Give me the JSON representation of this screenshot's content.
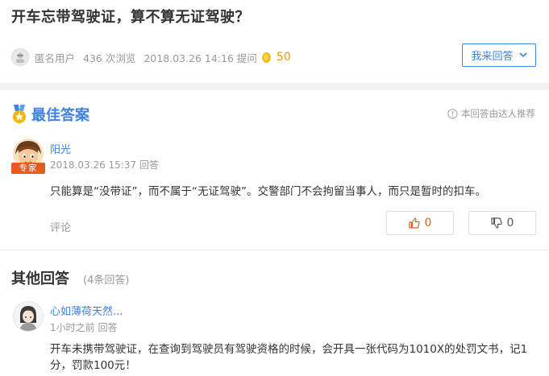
{
  "question": {
    "title": "开车忘带驾驶证，算不算无证驾驶？",
    "asker": "匿名用户",
    "views": "436 次浏览",
    "time": "2018.03.26 14:16 提问",
    "reward": "50",
    "answer_button": "我来回答"
  },
  "best_answer": {
    "heading": "最佳答案",
    "recommend_note": "本回答由达人推荐",
    "author": "阳光",
    "badge": "专家",
    "time": "2018.03.26 15:37 回答",
    "text": "只能算是“没带证”，而不属于“无证驾驶”。交警部门不会拘留当事人，而只是暂时的扣车。",
    "comment_label": "评论",
    "upvotes": "0",
    "downvotes": "0"
  },
  "other_answers": {
    "heading": "其他回答",
    "count": "(4条回答)",
    "items": [
      {
        "author": "心如薄荷天然...",
        "time": "1小时之前 回答",
        "text": "开车未携带驾驶证，在查询到驾驶员有驾驶资格的时候，会开具一张代码为1010X的处罚文书，记1分，罚款100元！"
      }
    ]
  },
  "colors": {
    "accent": "#3e83e1",
    "expert": "#e45c1e",
    "reward": "#f39800"
  },
  "icons": [
    "anonymous-avatar-icon",
    "gold-coin-icon",
    "chevron-down-icon",
    "best-answer-medal-icon",
    "info-circle-icon",
    "thumbs-up-icon",
    "thumbs-down-icon"
  ]
}
